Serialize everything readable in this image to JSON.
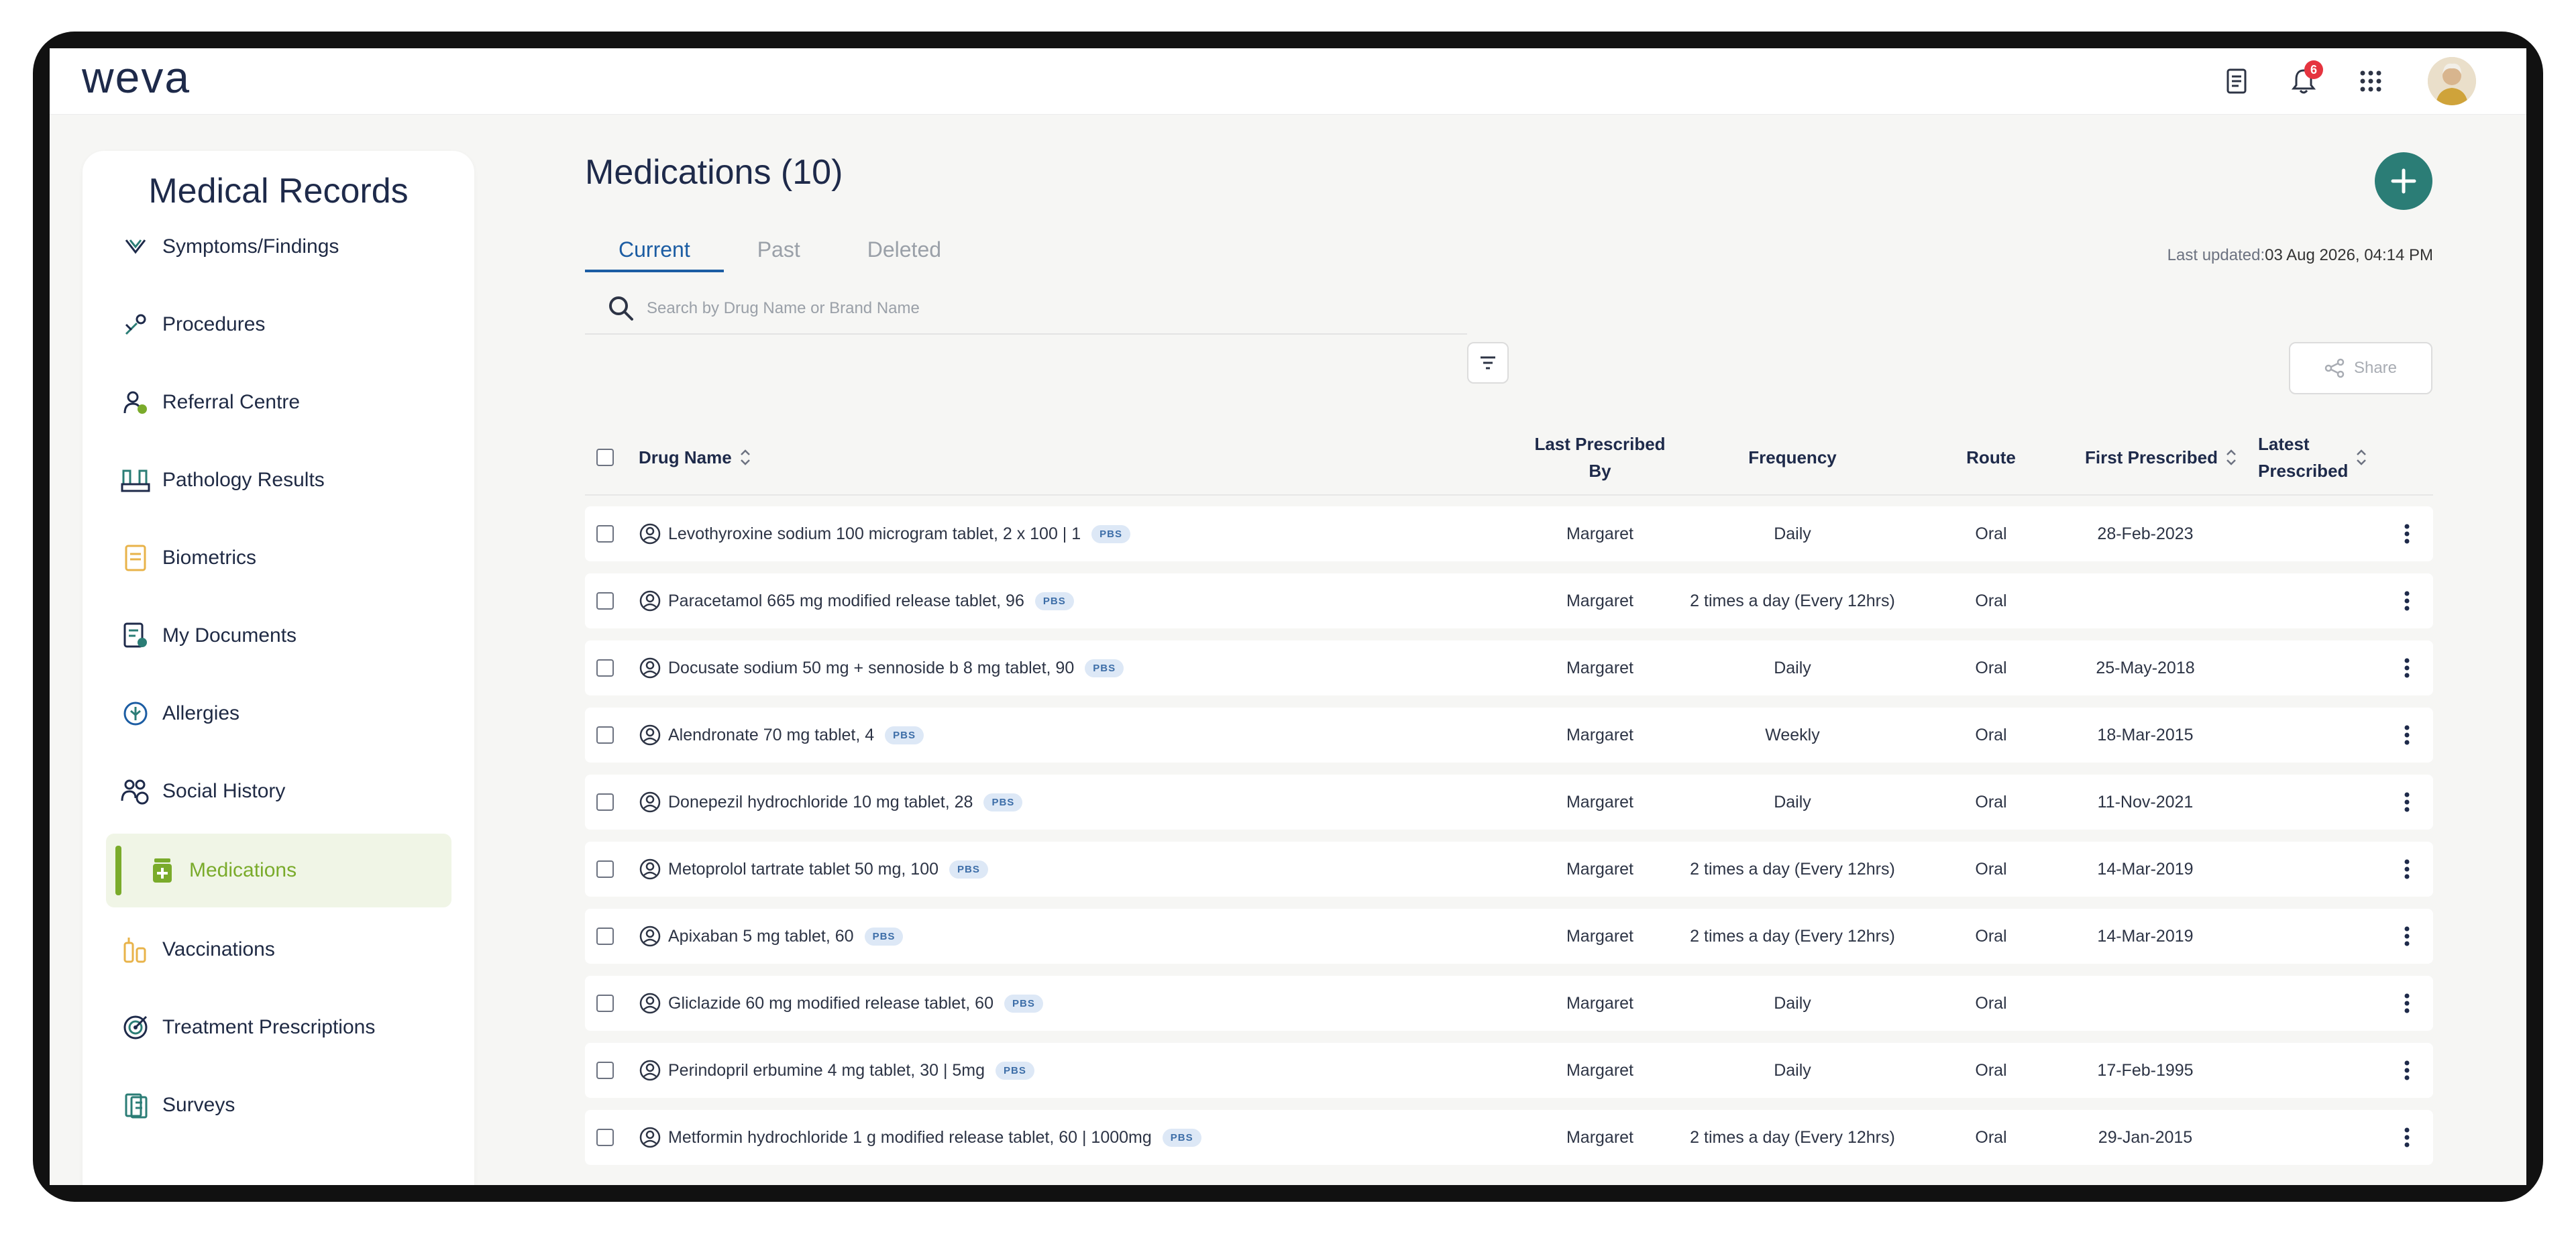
{
  "app": {
    "logo": "weva",
    "notification_count": "6"
  },
  "sidebar": {
    "title": "Medical Records",
    "items": [
      {
        "label": "Symptoms/Findings",
        "icon": "stethoscope-icon"
      },
      {
        "label": "Procedures",
        "icon": "procedure-icon"
      },
      {
        "label": "Referral Centre",
        "icon": "referral-icon"
      },
      {
        "label": "Pathology Results",
        "icon": "lab-icon"
      },
      {
        "label": "Biometrics",
        "icon": "biometrics-icon"
      },
      {
        "label": "My Documents",
        "icon": "documents-icon"
      },
      {
        "label": "Allergies",
        "icon": "allergies-icon"
      },
      {
        "label": "Social History",
        "icon": "social-history-icon"
      },
      {
        "label": "Medications",
        "icon": "medications-icon",
        "active": true
      },
      {
        "label": "Vaccinations",
        "icon": "vaccine-icon"
      },
      {
        "label": "Treatment Prescriptions",
        "icon": "target-icon"
      },
      {
        "label": "Surveys",
        "icon": "survey-icon"
      }
    ]
  },
  "main": {
    "title": "Medications (10)",
    "tabs": [
      {
        "label": "Current",
        "active": true
      },
      {
        "label": "Past"
      },
      {
        "label": "Deleted"
      }
    ],
    "last_updated_label": "Last updated:",
    "last_updated_value": "03 Aug 2026, 04:14 PM",
    "search_placeholder": "Search by Drug Name or Brand Name",
    "share_label": "Share",
    "columns": {
      "drug_name": "Drug Name",
      "last_prescribed_by_1": "Last Prescribed",
      "last_prescribed_by_2": "By",
      "frequency": "Frequency",
      "route": "Route",
      "first_prescribed": "First Prescribed",
      "latest_prescribed_1": "Latest",
      "latest_prescribed_2": "Prescribed"
    },
    "pbs_label": "PBS",
    "rows": [
      {
        "drug": "Levothyroxine sodium 100 microgram tablet, 2 x 100 | 1",
        "by": "Margaret",
        "frequency": "Daily",
        "route": "Oral",
        "first": "28-Feb-2023",
        "latest": ""
      },
      {
        "drug": "Paracetamol 665 mg modified release tablet, 96",
        "by": "Margaret",
        "frequency": "2 times a day (Every 12hrs)",
        "route": "Oral",
        "first": "",
        "latest": ""
      },
      {
        "drug": "Docusate sodium 50 mg + sennoside b 8 mg tablet, 90",
        "by": "Margaret",
        "frequency": "Daily",
        "route": "Oral",
        "first": "25-May-2018",
        "latest": ""
      },
      {
        "drug": "Alendronate 70 mg tablet, 4",
        "by": "Margaret",
        "frequency": "Weekly",
        "route": "Oral",
        "first": "18-Mar-2015",
        "latest": ""
      },
      {
        "drug": "Donepezil hydrochloride 10 mg tablet, 28",
        "by": "Margaret",
        "frequency": "Daily",
        "route": "Oral",
        "first": "11-Nov-2021",
        "latest": ""
      },
      {
        "drug": "Metoprolol tartrate tablet 50 mg, 100",
        "by": "Margaret",
        "frequency": "2 times a day (Every 12hrs)",
        "route": "Oral",
        "first": "14-Mar-2019",
        "latest": ""
      },
      {
        "drug": "Apixaban 5 mg tablet, 60",
        "by": "Margaret",
        "frequency": "2 times a day (Every 12hrs)",
        "route": "Oral",
        "first": "14-Mar-2019",
        "latest": ""
      },
      {
        "drug": "Gliclazide 60 mg modified release tablet, 60",
        "by": "Margaret",
        "frequency": "Daily",
        "route": "Oral",
        "first": "",
        "latest": ""
      },
      {
        "drug": "Perindopril erbumine 4 mg tablet, 30 | 5mg",
        "by": "Margaret",
        "frequency": "Daily",
        "route": "Oral",
        "first": "17-Feb-1995",
        "latest": ""
      },
      {
        "drug": "Metformin hydrochloride 1 g modified release tablet, 60 | 1000mg",
        "by": "Margaret",
        "frequency": "2 times a day (Every 12hrs)",
        "route": "Oral",
        "first": "29-Jan-2015",
        "latest": ""
      }
    ]
  },
  "colors": {
    "accent_green": "#7aab2b",
    "teal": "#2b7d76",
    "tab_blue": "#1c5da3",
    "badge_red": "#e5343f"
  }
}
